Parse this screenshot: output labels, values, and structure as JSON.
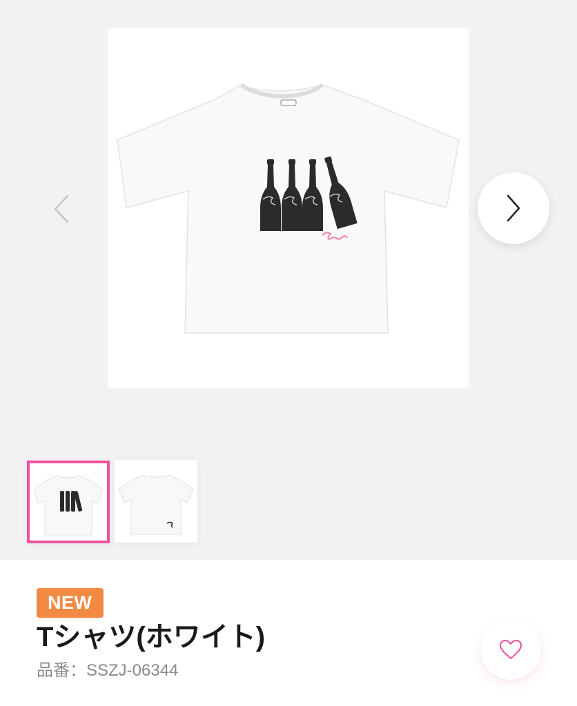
{
  "gallery": {
    "main_image": {
      "alt": "T-shirt front with bottle print"
    },
    "prev_icon": "chevron-left-icon",
    "next_icon": "chevron-right-icon",
    "thumbnails": [
      {
        "label": "front",
        "selected": true
      },
      {
        "label": "back",
        "selected": false
      }
    ],
    "selected_color": "#f0509f"
  },
  "product": {
    "badge": "NEW",
    "badge_color": "#f28a43",
    "title": "Tシャツ(ホワイト)",
    "sku": "品番：SSZJ-06344",
    "favorite_icon": "heart-icon",
    "favorite_color": "#e85aa8"
  }
}
